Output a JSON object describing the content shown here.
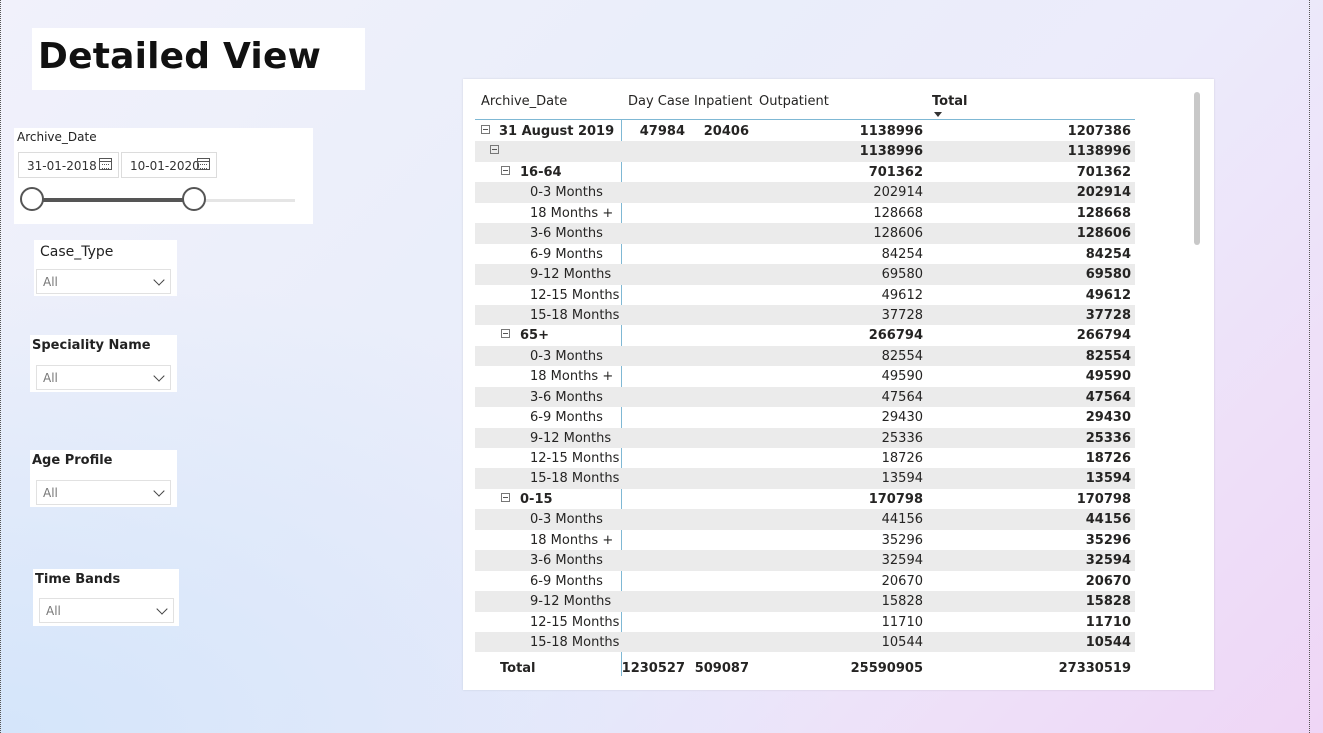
{
  "page": {
    "title": "Detailed View"
  },
  "date_slicer": {
    "label": "Archive_Date",
    "start": "31-01-2018",
    "end": "10-01-2020"
  },
  "slicers": [
    {
      "label": "Case_Type",
      "value": "All"
    },
    {
      "label": "Speciality Name",
      "value": "All"
    },
    {
      "label": "Age Profile",
      "value": "All"
    },
    {
      "label": "Time Bands",
      "value": "All"
    }
  ],
  "matrix": {
    "headers": {
      "row": "Archive_Date",
      "day_case": "Day Case",
      "inpatient": "Inpatient",
      "outpatient": "Outpatient",
      "total": "Total"
    },
    "rows": [
      {
        "label": "31 August 2019",
        "day_case": "47984",
        "inpatient": "20406",
        "outpatient": "1138996",
        "total": "1207386"
      },
      {
        "label": "",
        "day_case": "",
        "inpatient": "",
        "outpatient": "1138996",
        "total": "1138996"
      },
      {
        "label": "16-64",
        "day_case": "",
        "inpatient": "",
        "outpatient": "701362",
        "total": "701362"
      },
      {
        "label": "0-3 Months",
        "day_case": "",
        "inpatient": "",
        "outpatient": "202914",
        "total": "202914"
      },
      {
        "label": "18 Months +",
        "day_case": "",
        "inpatient": "",
        "outpatient": "128668",
        "total": "128668"
      },
      {
        "label": "3-6 Months",
        "day_case": "",
        "inpatient": "",
        "outpatient": "128606",
        "total": "128606"
      },
      {
        "label": "6-9 Months",
        "day_case": "",
        "inpatient": "",
        "outpatient": "84254",
        "total": "84254"
      },
      {
        "label": "9-12 Months",
        "day_case": "",
        "inpatient": "",
        "outpatient": "69580",
        "total": "69580"
      },
      {
        "label": "12-15 Months",
        "day_case": "",
        "inpatient": "",
        "outpatient": "49612",
        "total": "49612"
      },
      {
        "label": "15-18 Months",
        "day_case": "",
        "inpatient": "",
        "outpatient": "37728",
        "total": "37728"
      },
      {
        "label": "65+",
        "day_case": "",
        "inpatient": "",
        "outpatient": "266794",
        "total": "266794"
      },
      {
        "label": "0-3 Months",
        "day_case": "",
        "inpatient": "",
        "outpatient": "82554",
        "total": "82554"
      },
      {
        "label": "18 Months +",
        "day_case": "",
        "inpatient": "",
        "outpatient": "49590",
        "total": "49590"
      },
      {
        "label": "3-6 Months",
        "day_case": "",
        "inpatient": "",
        "outpatient": "47564",
        "total": "47564"
      },
      {
        "label": "6-9 Months",
        "day_case": "",
        "inpatient": "",
        "outpatient": "29430",
        "total": "29430"
      },
      {
        "label": "9-12 Months",
        "day_case": "",
        "inpatient": "",
        "outpatient": "25336",
        "total": "25336"
      },
      {
        "label": "12-15 Months",
        "day_case": "",
        "inpatient": "",
        "outpatient": "18726",
        "total": "18726"
      },
      {
        "label": "15-18 Months",
        "day_case": "",
        "inpatient": "",
        "outpatient": "13594",
        "total": "13594"
      },
      {
        "label": "0-15",
        "day_case": "",
        "inpatient": "",
        "outpatient": "170798",
        "total": "170798"
      },
      {
        "label": "0-3 Months",
        "day_case": "",
        "inpatient": "",
        "outpatient": "44156",
        "total": "44156"
      },
      {
        "label": "18 Months +",
        "day_case": "",
        "inpatient": "",
        "outpatient": "35296",
        "total": "35296"
      },
      {
        "label": "3-6 Months",
        "day_case": "",
        "inpatient": "",
        "outpatient": "32594",
        "total": "32594"
      },
      {
        "label": "6-9 Months",
        "day_case": "",
        "inpatient": "",
        "outpatient": "20670",
        "total": "20670"
      },
      {
        "label": "9-12 Months",
        "day_case": "",
        "inpatient": "",
        "outpatient": "15828",
        "total": "15828"
      },
      {
        "label": "12-15 Months",
        "day_case": "",
        "inpatient": "",
        "outpatient": "11710",
        "total": "11710"
      },
      {
        "label": "15-18 Months",
        "day_case": "",
        "inpatient": "",
        "outpatient": "10544",
        "total": "10544"
      }
    ],
    "total_row": {
      "label": "Total",
      "day_case": "1230527",
      "inpatient": "509087",
      "outpatient": "25590905",
      "total": "27330519"
    }
  }
}
